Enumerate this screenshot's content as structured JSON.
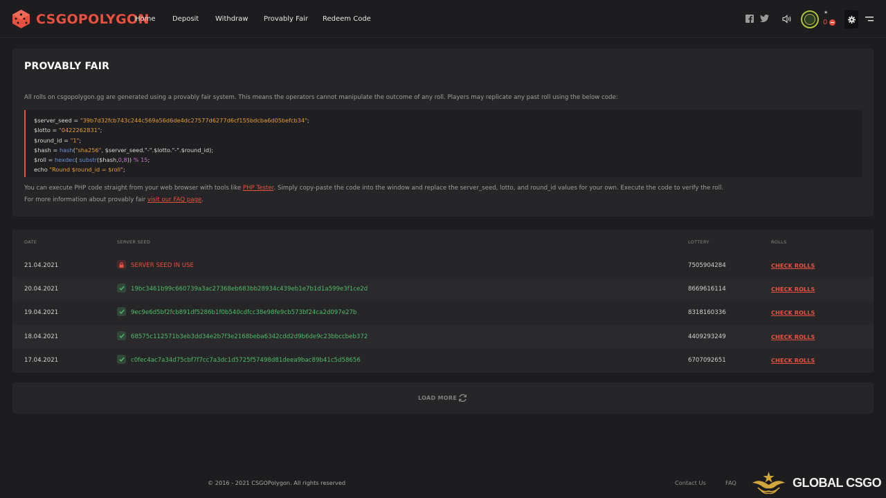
{
  "brand": {
    "name": "CSGOPOLYGON",
    "accent": "#e8503f"
  },
  "nav": {
    "items": [
      "Home",
      "Deposit",
      "Withdraw",
      "Provably Fair",
      "Redeem Code"
    ]
  },
  "header_right": {
    "icons": [
      "facebook-icon",
      "twitter-icon",
      "speaker-icon",
      "avatar",
      "gear-icon",
      "menu-icon"
    ],
    "balance_star": "★",
    "balance": "0"
  },
  "provably_fair": {
    "title": "PROVABLY FAIR",
    "intro": "All rolls on csgopolygon.gg are generated using a provably fair system. This means the operators cannot manipulate the outcome of any roll. Players may replicate any past roll using the below code:",
    "code": {
      "l1_var": "$server_seed = ",
      "l1_str": "\"39b7d32fcb743c244c569a56d6de4dc27577d6277d6cf155bdcba6d05befcb34\"",
      "l1_end": ";",
      "l2_var": "$lotto = ",
      "l2_str": "\"0422262831\"",
      "l2_end": ";",
      "l3_var": "$round_id = ",
      "l3_str": "\"1\"",
      "l3_end": ";",
      "l4_a": "$hash = ",
      "l4_fn": "hash",
      "l4_b": "(",
      "l4_str": "\"sha256\"",
      "l4_c": ", $server_seed.\"-\".$lotto.\"-\".$round_id);",
      "l5_a": "$roll = ",
      "l5_fn1": "hexdec",
      "l5_b": "( ",
      "l5_fn2": "substr",
      "l5_c": "($hash,",
      "l5_num1": "0",
      "l5_d": ",",
      "l5_num2": "8",
      "l5_e": ")) ",
      "l5_num3": "% 15",
      "l5_f": ";",
      "l6_a": "echo ",
      "l6_str": "\"Round $round_id = $roll\"",
      "l6_end": ";"
    },
    "note1_a": "You can execute PHP code straight from your web browser with tools like ",
    "note1_link": "PHP Tester",
    "note1_b": ". Simply copy-paste the code into the window and replace the server_seed, lotto, and round_id values for your own. Execute the code to verify the roll.",
    "note2_a": "For more information about provably fair ",
    "note2_link": "visit our FAQ page",
    "note2_b": "."
  },
  "table": {
    "headers": {
      "date": "DATE",
      "seed": "SERVER SEED",
      "lottery": "LOTTERY",
      "rolls": "ROLLS"
    },
    "rows": [
      {
        "date": "21.04.2021",
        "seed": "SERVER SEED IN USE",
        "lottery": "7505904284",
        "rolls": "CHECK ROLLS"
      },
      {
        "date": "20.04.2021",
        "seed": "19bc3461b99c660739a3ac27368eb683bb28934c439eb1e7b1d1a599e3f1ce2d",
        "lottery": "8669616114",
        "rolls": "CHECK ROLLS"
      },
      {
        "date": "19.04.2021",
        "seed": "9ec9e6d5bf2fcb891df5286b1f0b540cdfcc38e98fe9cb573bf24ca2d097e27b",
        "lottery": "8318160336",
        "rolls": "CHECK ROLLS"
      },
      {
        "date": "18.04.2021",
        "seed": "68575c112571b3eb3dd34e2b7f3e2168beba6342cdd2d9b6de9c23bbccbeb372",
        "lottery": "4409293249",
        "rolls": "CHECK ROLLS"
      },
      {
        "date": "17.04.2021",
        "seed": "c0fec4ac7a34d75cbf7f7cc7a3dc1d5725f57498d81deea9bac89b41c5d58656",
        "lottery": "6707092651",
        "rolls": "CHECK ROLLS"
      }
    ]
  },
  "load_more": "LOAD MORE",
  "footer": {
    "copyright": "© 2016 - 2021 CSGOPolygon. All rights reserved",
    "contact": "Contact Us",
    "faq": "FAQ",
    "watermark": "GLOBAL CSGO"
  }
}
